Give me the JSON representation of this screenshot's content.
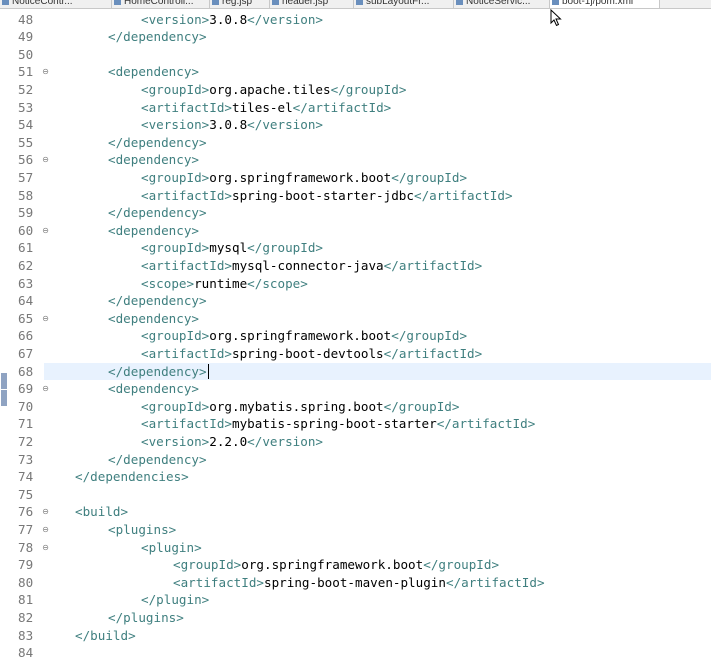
{
  "tabs": [
    {
      "label": "NoticeContr...",
      "active": false
    },
    {
      "label": "HomeControll...",
      "active": false
    },
    {
      "label": "reg.jsp",
      "active": false
    },
    {
      "label": "header.jsp",
      "active": false
    },
    {
      "label": "subLayoutFr...",
      "active": false
    },
    {
      "label": "NoticeServic...",
      "active": false
    },
    {
      "label": "boot-1j/pom.xml",
      "active": true
    }
  ],
  "editor": {
    "current_line": 68,
    "lines": [
      {
        "n": "48",
        "indent": 3,
        "open": "<version>",
        "text": "3.0.8",
        "close": "</version>"
      },
      {
        "n": "49",
        "indent": 2,
        "open": "",
        "text": "",
        "close": "</dependency>"
      },
      {
        "n": "50",
        "indent": 0,
        "open": "",
        "text": "",
        "close": ""
      },
      {
        "n": "51",
        "indent": 2,
        "open": "<dependency>",
        "text": "",
        "close": "",
        "fold": true
      },
      {
        "n": "52",
        "indent": 3,
        "open": "<groupId>",
        "text": "org.apache.tiles",
        "close": "</groupId>"
      },
      {
        "n": "53",
        "indent": 3,
        "open": "<artifactId>",
        "text": "tiles-el",
        "close": "</artifactId>"
      },
      {
        "n": "54",
        "indent": 3,
        "open": "<version>",
        "text": "3.0.8",
        "close": "</version>"
      },
      {
        "n": "55",
        "indent": 2,
        "open": "",
        "text": "",
        "close": "</dependency>"
      },
      {
        "n": "56",
        "indent": 2,
        "open": "<dependency>",
        "text": "",
        "close": "",
        "fold": true
      },
      {
        "n": "57",
        "indent": 3,
        "open": "<groupId>",
        "text": "org.springframework.boot",
        "close": "</groupId>"
      },
      {
        "n": "58",
        "indent": 3,
        "open": "<artifactId>",
        "text": "spring-boot-starter-jdbc",
        "close": "</artifactId>"
      },
      {
        "n": "59",
        "indent": 2,
        "open": "",
        "text": "",
        "close": "</dependency>"
      },
      {
        "n": "60",
        "indent": 2,
        "open": "<dependency>",
        "text": "",
        "close": "",
        "fold": true
      },
      {
        "n": "61",
        "indent": 3,
        "open": "<groupId>",
        "text": "mysql",
        "close": "</groupId>"
      },
      {
        "n": "62",
        "indent": 3,
        "open": "<artifactId>",
        "text": "mysql-connector-java",
        "close": "</artifactId>"
      },
      {
        "n": "63",
        "indent": 3,
        "open": "<scope>",
        "text": "runtime",
        "close": "</scope>"
      },
      {
        "n": "64",
        "indent": 2,
        "open": "",
        "text": "",
        "close": "</dependency>"
      },
      {
        "n": "65",
        "indent": 2,
        "open": "<dependency>",
        "text": "",
        "close": "",
        "fold": true
      },
      {
        "n": "66",
        "indent": 3,
        "open": "<groupId>",
        "text": "org.springframework.boot",
        "close": "</groupId>"
      },
      {
        "n": "67",
        "indent": 3,
        "open": "<artifactId>",
        "text": "spring-boot-devtools",
        "close": "</artifactId>"
      },
      {
        "n": "68",
        "indent": 2,
        "open": "",
        "text": "",
        "close": "</dependency>",
        "mark": true
      },
      {
        "n": "69",
        "indent": 2,
        "open": "<dependency>",
        "text": "",
        "close": "",
        "fold": true,
        "mark": true
      },
      {
        "n": "70",
        "indent": 3,
        "open": "<groupId>",
        "text": "org.mybatis.spring.boot",
        "close": "</groupId>"
      },
      {
        "n": "71",
        "indent": 3,
        "open": "<artifactId>",
        "text": "mybatis-spring-boot-starter",
        "close": "</artifactId>"
      },
      {
        "n": "72",
        "indent": 3,
        "open": "<version>",
        "text": "2.2.0",
        "close": "</version>"
      },
      {
        "n": "73",
        "indent": 2,
        "open": "",
        "text": "",
        "close": "</dependency>"
      },
      {
        "n": "74",
        "indent": 1,
        "open": "",
        "text": "",
        "close": "</dependencies>"
      },
      {
        "n": "75",
        "indent": 0,
        "open": "",
        "text": "",
        "close": ""
      },
      {
        "n": "76",
        "indent": 1,
        "open": "<build>",
        "text": "",
        "close": "",
        "fold": true
      },
      {
        "n": "77",
        "indent": 2,
        "open": "<plugins>",
        "text": "",
        "close": "",
        "fold": true
      },
      {
        "n": "78",
        "indent": 3,
        "open": "<plugin>",
        "text": "",
        "close": "",
        "fold": true
      },
      {
        "n": "79",
        "indent": 4,
        "open": "<groupId>",
        "text": "org.springframework.boot",
        "close": "</groupId>"
      },
      {
        "n": "80",
        "indent": 4,
        "open": "<artifactId>",
        "text": "spring-boot-maven-plugin",
        "close": "</artifactId>"
      },
      {
        "n": "81",
        "indent": 3,
        "open": "",
        "text": "",
        "close": "</plugin>"
      },
      {
        "n": "82",
        "indent": 2,
        "open": "",
        "text": "",
        "close": "</plugins>"
      },
      {
        "n": "83",
        "indent": 1,
        "open": "",
        "text": "",
        "close": "</build>"
      },
      {
        "n": "84",
        "indent": 0,
        "open": "",
        "text": "",
        "close": ""
      }
    ]
  }
}
